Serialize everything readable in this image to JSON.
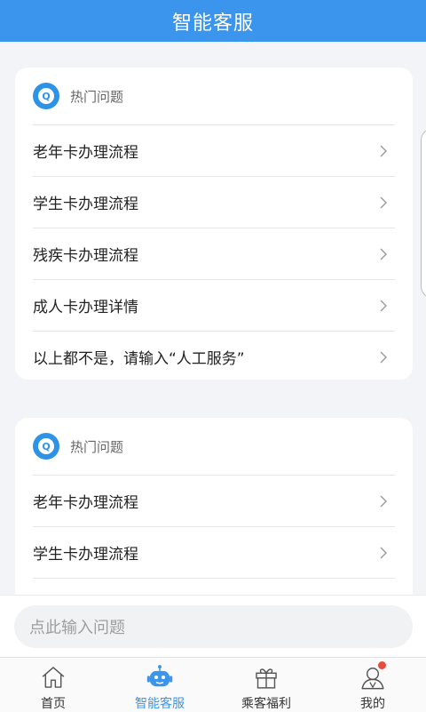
{
  "header": {
    "title": "智能客服"
  },
  "cards": [
    {
      "title": "热门问题",
      "icon": "q-bubble-icon",
      "questions": [
        "老年卡办理流程",
        "学生卡办理流程",
        "残疾卡办理流程",
        "成人卡办理详情",
        "以上都不是，请输入“人工服务”"
      ]
    },
    {
      "title": "热门问题",
      "icon": "q-bubble-icon",
      "questions": [
        "老年卡办理流程",
        "学生卡办理流程"
      ]
    }
  ],
  "input": {
    "placeholder": "点此输入问题"
  },
  "tabs": [
    {
      "label": "首页",
      "icon": "home-icon",
      "active": false
    },
    {
      "label": "智能客服",
      "icon": "robot-icon",
      "active": true
    },
    {
      "label": "乘客福利",
      "icon": "gift-icon",
      "active": false
    },
    {
      "label": "我的",
      "icon": "user-icon",
      "active": false,
      "badge": true
    }
  ],
  "colors": {
    "accent": "#3b95ec",
    "background": "#f2f4f7",
    "badge": "#e74c3c"
  }
}
